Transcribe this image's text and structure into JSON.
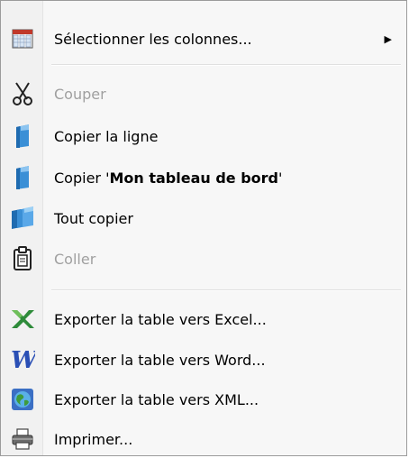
{
  "menu": {
    "select_columns": {
      "label": "Sélectionner les colonnes...",
      "icon": "columns-icon",
      "submenu_arrow": "▶"
    },
    "cut": {
      "label": "Couper",
      "icon": "scissors-icon",
      "disabled": true
    },
    "copy_line": {
      "label": "Copier la ligne",
      "icon": "copy-page-icon"
    },
    "copy_dashboard": {
      "prefix": "Copier '",
      "bold": "Mon tableau de bord",
      "suffix": "'",
      "icon": "copy-page-icon"
    },
    "copy_all": {
      "label": "Tout copier",
      "icon": "copy-all-icon"
    },
    "paste": {
      "label": "Coller",
      "icon": "clipboard-icon",
      "disabled": true
    },
    "export_excel": {
      "label": "Exporter la table vers Excel...",
      "icon": "excel-icon"
    },
    "export_word": {
      "label": "Exporter la table vers Word...",
      "icon": "word-icon"
    },
    "export_xml": {
      "label": "Exporter la table vers XML...",
      "icon": "xml-globe-icon"
    },
    "print": {
      "label": "Imprimer...",
      "icon": "printer-icon"
    }
  },
  "colors": {
    "excel_green": "#2e8b3a",
    "word_blue": "#2a4fb5",
    "copy_blue": "#3a8fd6",
    "disabled_text": "#a0a0a0"
  }
}
